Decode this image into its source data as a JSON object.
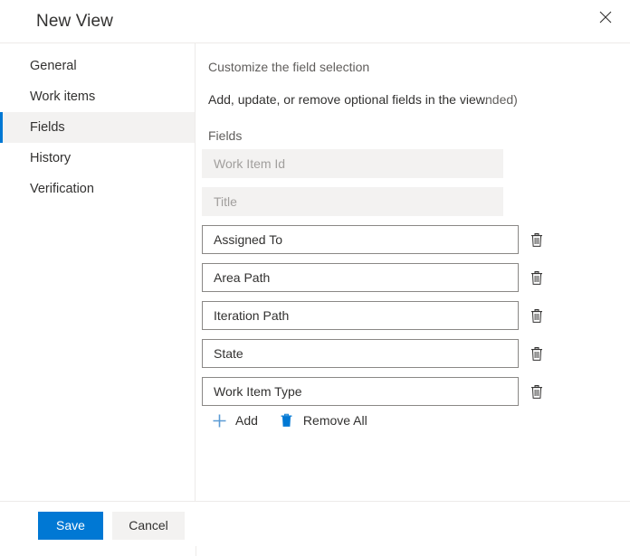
{
  "dialog": {
    "title": "New View",
    "close_icon": "close-icon"
  },
  "sidebar": {
    "items": [
      {
        "label": "General",
        "selected": false
      },
      {
        "label": "Work items",
        "selected": false
      },
      {
        "label": "Fields",
        "selected": true
      },
      {
        "label": "History",
        "selected": false
      },
      {
        "label": "Verification",
        "selected": false
      }
    ]
  },
  "main": {
    "section_title": "Customize the field selection",
    "section_description": "Add, update, or remove optional fields in the view.",
    "section_description_extra": "nded)",
    "fields_label": "Fields",
    "fields": [
      {
        "value": "Work Item Id",
        "disabled": true,
        "deletable": false
      },
      {
        "value": "Title",
        "disabled": true,
        "deletable": false
      },
      {
        "value": "Assigned To",
        "disabled": false,
        "deletable": true
      },
      {
        "value": "Area Path",
        "disabled": false,
        "deletable": true
      },
      {
        "value": "Iteration Path",
        "disabled": false,
        "deletable": true
      },
      {
        "value": "State",
        "disabled": false,
        "deletable": true
      },
      {
        "value": "Work Item Type",
        "disabled": false,
        "deletable": true
      }
    ],
    "actions": {
      "add_label": "Add",
      "add_icon": "plus-icon",
      "remove_all_label": "Remove All",
      "remove_all_icon": "trash-icon"
    },
    "delete_icon": "trash-icon"
  },
  "footer": {
    "save_label": "Save",
    "cancel_label": "Cancel"
  },
  "colors": {
    "accent": "#0078d4",
    "accent_light": "#5b9bd5",
    "selected_bg": "#f3f2f1",
    "border": "#8a8886",
    "divider": "#edebe9",
    "text": "#323130",
    "text_secondary": "#605e5c",
    "text_disabled": "#a19f9d"
  }
}
